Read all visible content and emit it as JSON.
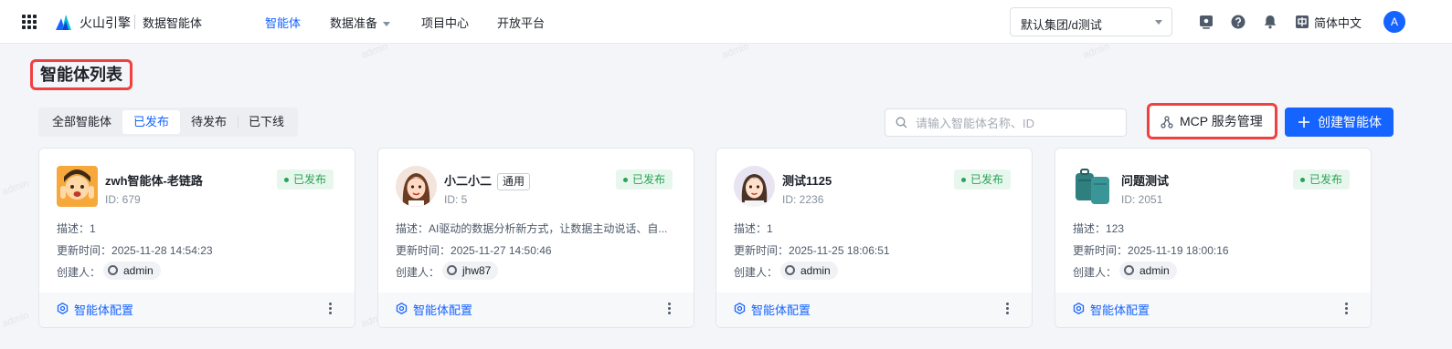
{
  "header": {
    "brand": "火山引擎",
    "product": "数据智能体",
    "nav": [
      {
        "label": "智能体",
        "active": true
      },
      {
        "label": "数据准备",
        "dropdown": true
      },
      {
        "label": "项目中心"
      },
      {
        "label": "开放平台"
      }
    ],
    "org_select": "默认集团/d测试",
    "language": "简体中文",
    "avatar_letter": "A",
    "icons": [
      "apps-grid-icon",
      "volcano-logo-icon",
      "screen-icon",
      "help-icon",
      "bell-icon",
      "translate-icon"
    ]
  },
  "page": {
    "title": "智能体列表",
    "tabs": [
      {
        "label": "全部智能体"
      },
      {
        "label": "已发布",
        "active": true
      },
      {
        "label": "待发布"
      },
      {
        "label": "已下线"
      }
    ],
    "search_placeholder": "请输入智能体名称、ID",
    "mcp_button": "MCP 服务管理",
    "create_button": "创建智能体"
  },
  "labels": {
    "desc": "描述：",
    "updated": "更新时间：",
    "creator": "创建人：",
    "config": "智能体配置"
  },
  "cards": [
    {
      "name": "zwh智能体-老链路",
      "id": "ID: 679",
      "status": "已发布",
      "desc": "1",
      "updated": "2025-11-28 14:54:23",
      "creator": "admin",
      "avatar": "cartoon-kid"
    },
    {
      "name": "小二小二",
      "tag": "通用",
      "id": "ID: 5",
      "status": "已发布",
      "desc": "AI驱动的数据分析新方式，让数据主动说话、自...",
      "updated": "2025-11-27 14:50:46",
      "creator": "jhw87",
      "avatar": "woman-portrait"
    },
    {
      "name": "测试1125",
      "id": "ID: 2236",
      "status": "已发布",
      "desc": "1",
      "updated": "2025-11-25 18:06:51",
      "creator": "admin",
      "avatar": "woman-portrait-2"
    },
    {
      "name": "问题测试",
      "id": "ID: 2051",
      "status": "已发布",
      "desc": "123",
      "updated": "2025-11-19 18:00:16",
      "creator": "admin",
      "avatar": "luggage"
    }
  ],
  "watermark": "admin",
  "colors": {
    "accent": "#1664ff",
    "status_green": "#2aa355",
    "highlight_red": "#f04040"
  }
}
